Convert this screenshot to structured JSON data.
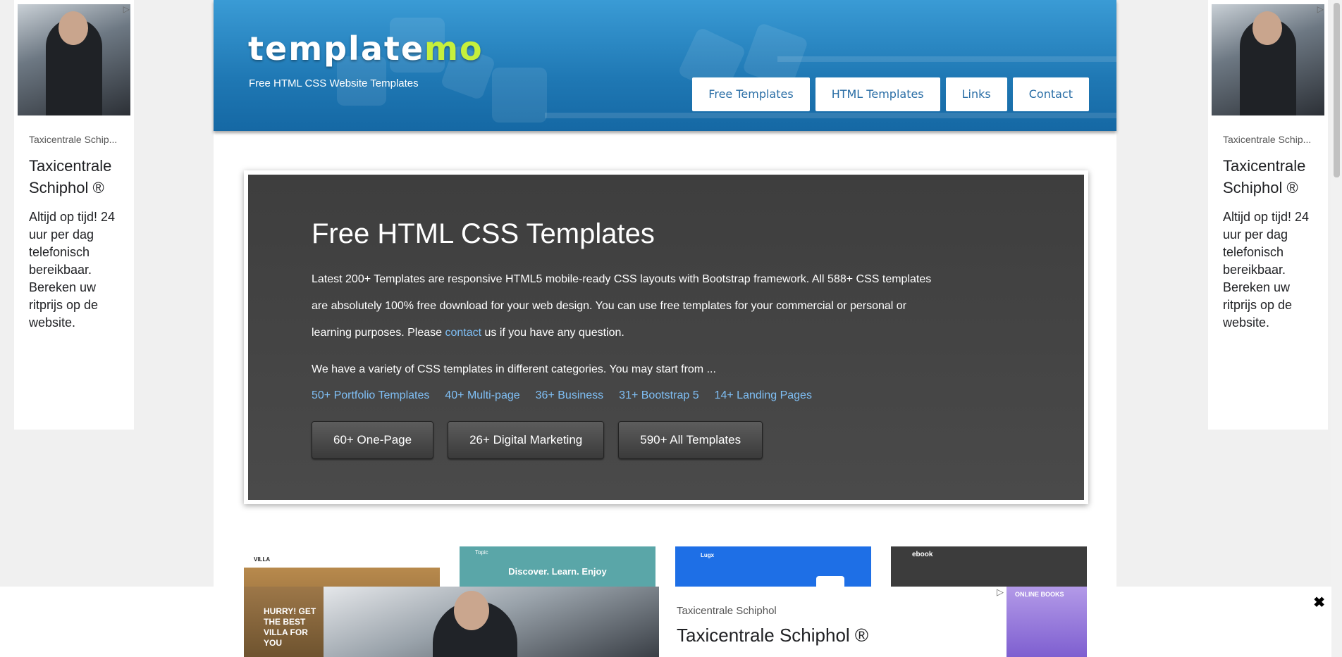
{
  "header": {
    "logo_main": "template",
    "logo_accent": "mo",
    "tagline": "Free HTML CSS Website Templates",
    "nav": [
      "Free Templates",
      "HTML Templates",
      "Links",
      "Contact"
    ]
  },
  "hero": {
    "title": "Free HTML CSS Templates",
    "lead_before": "Latest 200+ Templates are responsive HTML5 mobile-ready CSS layouts with Bootstrap framework. All 588+ CSS templates are absolutely 100% free download for your web design. You can use free templates for your commercial or personal or learning purposes. Please ",
    "lead_link": "contact",
    "lead_after": " us if you have any question.",
    "intro": "We have a variety of CSS templates in different categories. You may start from ...",
    "categories": [
      "50+ Portfolio Templates",
      "40+ Multi-page",
      "36+ Business",
      "31+ Bootstrap 5",
      "14+ Landing Pages"
    ],
    "buttons": [
      "60+ One-Page",
      "26+ Digital Marketing",
      "590+ All Templates"
    ]
  },
  "thumbs": {
    "t1_title": "VILLA",
    "t1_hurry": "HURRY! GET THE BEST VILLA FOR YOU",
    "t2_brand": "Topic",
    "t2_title": "Discover. Learn. Enjoy",
    "t3_brand": "Lugx",
    "t4_brand": "ebook"
  },
  "ads": {
    "small": "Taxicentrale Schip...",
    "title": "Taxicentrale Schiphol ®",
    "body": "Altijd op tijd! 24 uur per dag telefonisch bereikbaar. Bereken uw ritprijs op de website.",
    "choice_icon": "adchoices-icon",
    "bottom_small": "Taxicentrale Schiphol",
    "bottom_title": "Taxicentrale Schiphol ®",
    "bottom_left": "HURRY! GET THE BEST VILLA FOR YOU",
    "bottom_right": "ONLINE BOOKS",
    "close": "✖"
  }
}
